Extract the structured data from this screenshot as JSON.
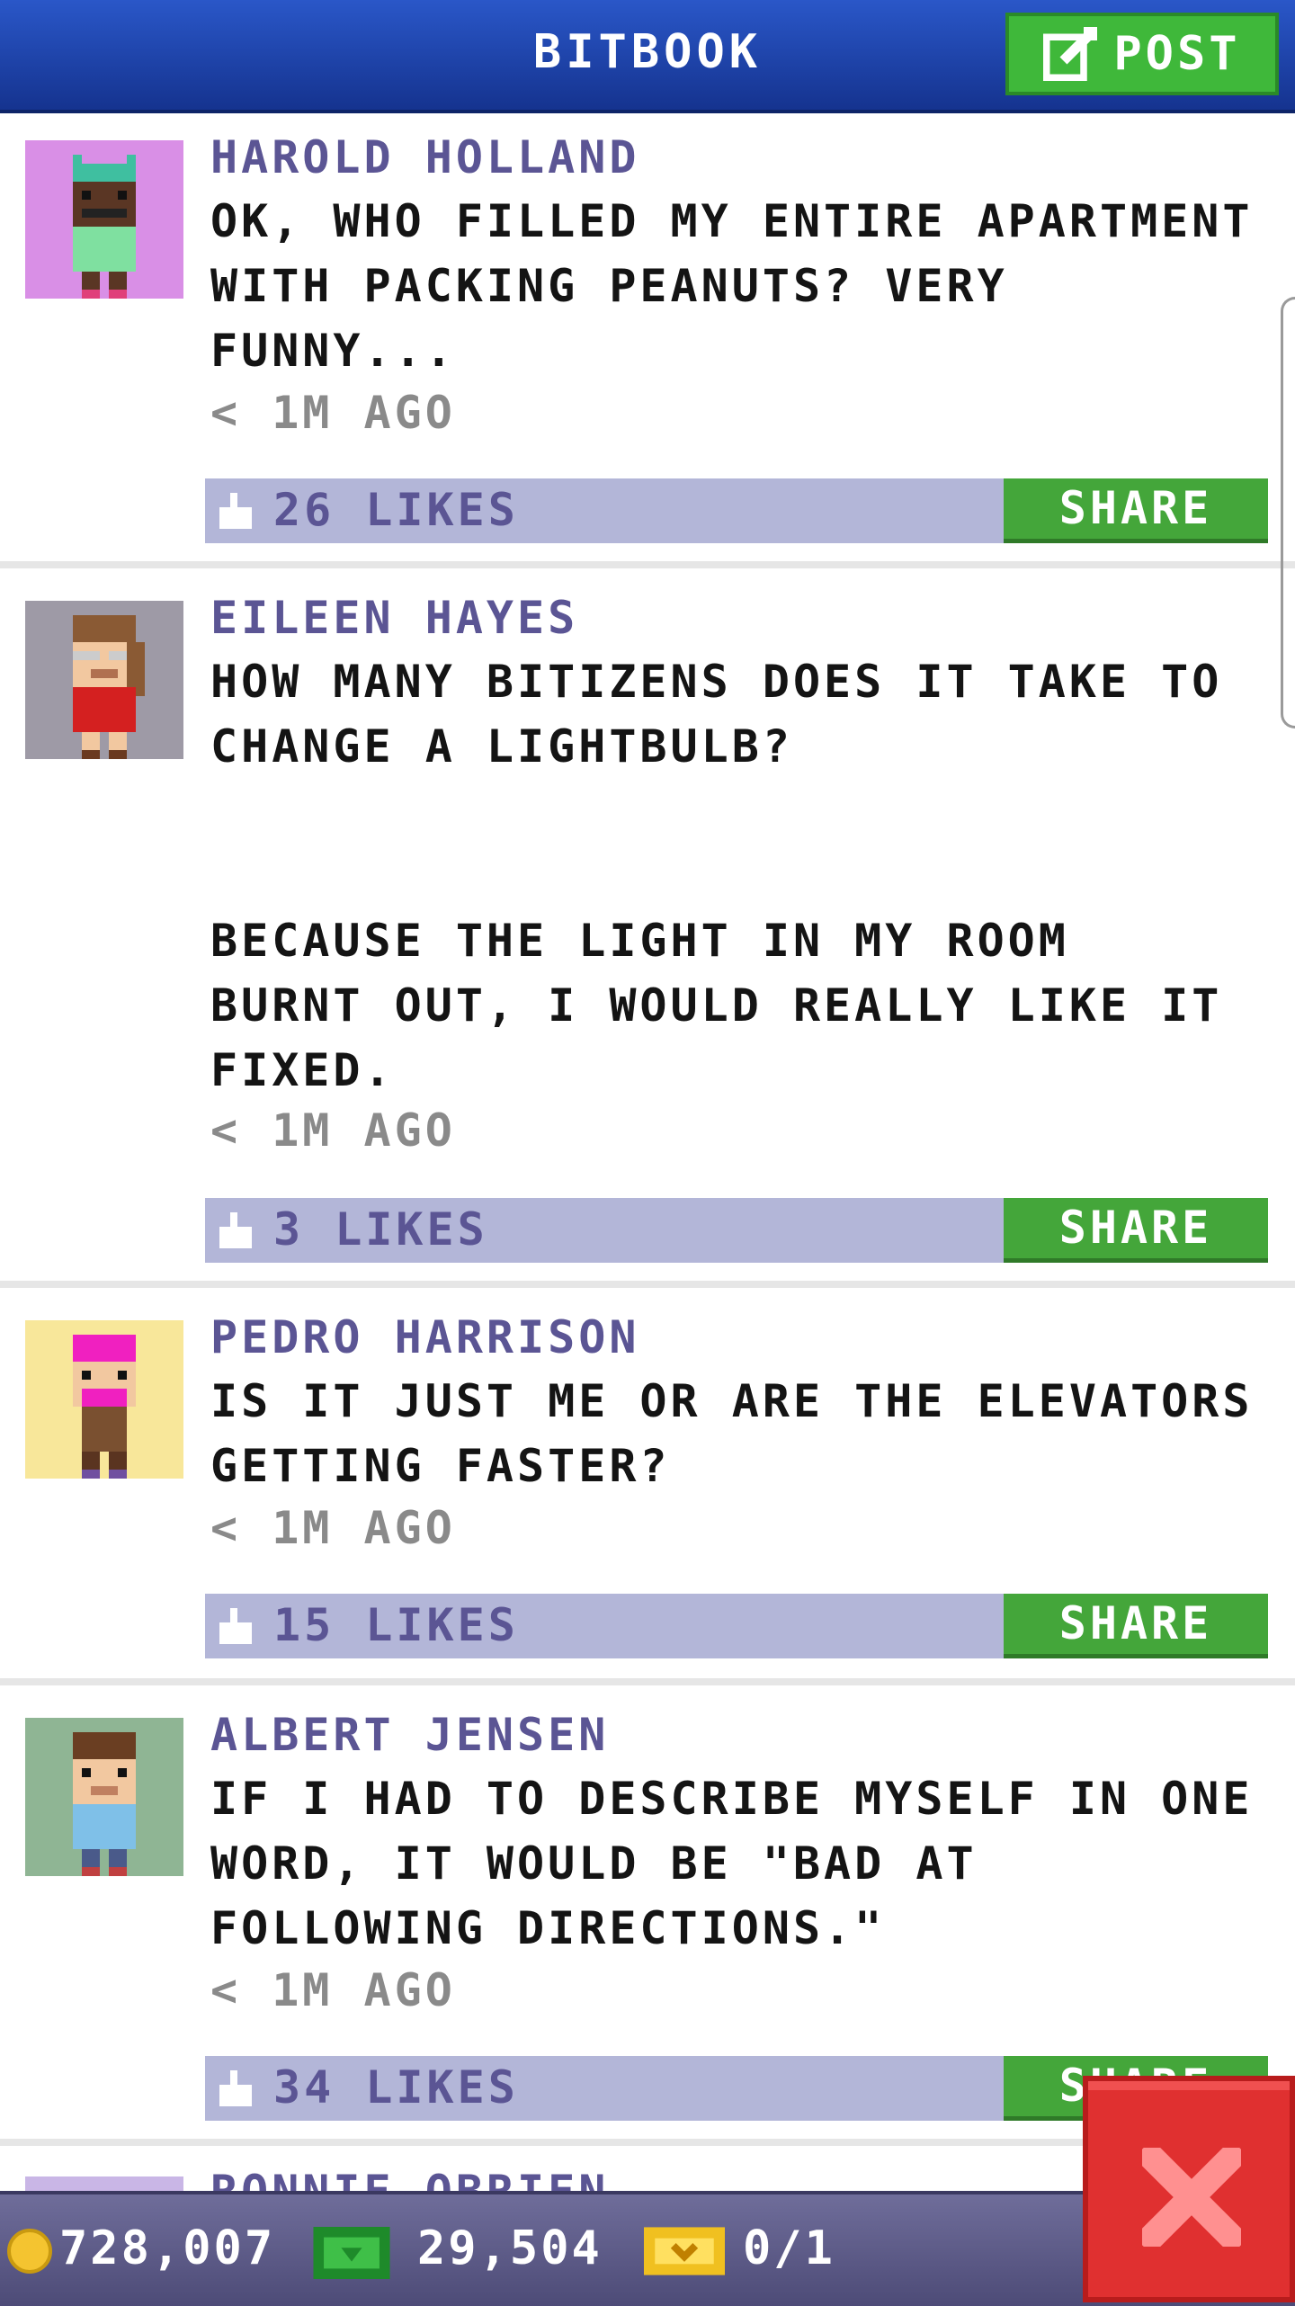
{
  "header": {
    "title": "BITBOOK",
    "post_label": "POST"
  },
  "posts": [
    {
      "name": "HAROLD HOLLAND",
      "text": "OK, WHO FILLED MY ENTIRE APARTMENT\nWITH PACKING PEANUTS? VERY\nFUNNY...",
      "time": "< 1M AGO",
      "likes": "26 LIKES",
      "share": "SHARE",
      "avatar_bg": "#d98fe6"
    },
    {
      "name": "EILEEN HAYES",
      "text": "HOW MANY BITIZENS DOES IT TAKE TO\nCHANGE A LIGHTBULB?\n\n\nBECAUSE THE LIGHT IN MY ROOM\nBURNT OUT, I WOULD REALLY LIKE IT\nFIXED.",
      "time": "< 1M AGO",
      "likes": "3 LIKES",
      "share": "SHARE",
      "avatar_bg": "#9e9aa6"
    },
    {
      "name": "PEDRO HARRISON",
      "text": "IS IT JUST ME OR ARE THE ELEVATORS\nGETTING FASTER?",
      "time": "< 1M AGO",
      "likes": "15 LIKES",
      "share": "SHARE",
      "avatar_bg": "#f8e79a"
    },
    {
      "name": "ALBERT JENSEN",
      "text": "IF I HAD TO DESCRIBE MYSELF IN ONE\nWORD, IT WOULD BE \"BAD AT\nFOLLOWING DIRECTIONS.\"",
      "time": "< 1M AGO",
      "likes": "34 LIKES",
      "share": "SHARE",
      "avatar_bg": "#8fb594"
    },
    {
      "name": "RONNIE OBRIEN",
      "avatar_bg": "#c9b6e6"
    }
  ],
  "stats": {
    "coins": "728,007",
    "bux": "29,504",
    "tickets": "0/1"
  },
  "colors": {
    "header": "#1e44ad",
    "post_button": "#3fb83a",
    "name": "#5b5594",
    "like_bar": "#b3b6d8",
    "share_button": "#44a63a",
    "close_button": "#e03030"
  },
  "icons": {
    "post": "edit-icon",
    "like": "thumbs-up-icon",
    "coin": "coin-icon",
    "bux": "bux-icon",
    "ticket": "ticket-icon",
    "close": "close-icon"
  }
}
